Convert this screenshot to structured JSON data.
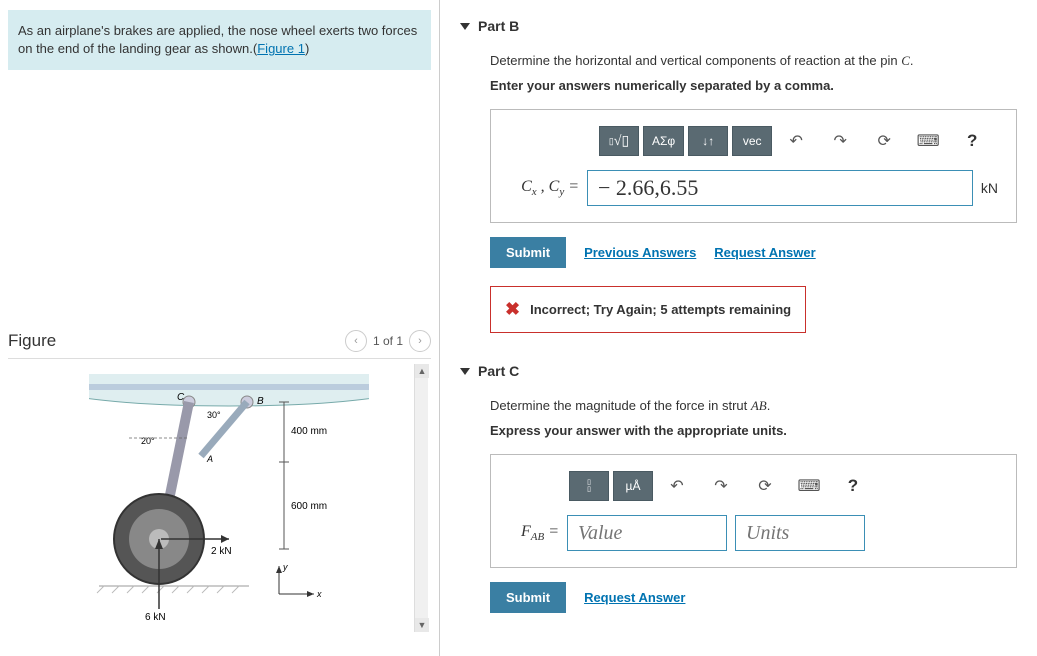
{
  "problem": {
    "text_before": "As an airplane's brakes are applied, the nose wheel exerts two forces on the end of the landing gear as shown.(",
    "link": "Figure 1",
    "text_after": ")"
  },
  "figure": {
    "title": "Figure",
    "pager": "1 of 1",
    "labels": {
      "angle1": "30°",
      "angle2": "20°",
      "dim1": "400 mm",
      "dim2": "600 mm",
      "f1": "2 kN",
      "f2": "6 kN",
      "ptB": "B",
      "ptC": "C",
      "ptA": "A",
      "x": "x",
      "y": "y"
    }
  },
  "partB": {
    "title": "Part B",
    "prompt_before": "Determine the horizontal and vertical components of reaction at the pin ",
    "prompt_var": "C",
    "prompt_after": ".",
    "instruction": "Enter your answers numerically separated by a comma.",
    "toolbar": {
      "symbols": "ΑΣφ",
      "vec": "vec"
    },
    "label_cx": "C",
    "label_sub_x": "x",
    "label_cy": "C",
    "label_sub_y": "y",
    "value": "− 2.66,6.55",
    "unit": "kN",
    "submit": "Submit",
    "prev_answers": "Previous Answers",
    "request_answer": "Request Answer",
    "feedback": "Incorrect; Try Again; 5 attempts remaining"
  },
  "partC": {
    "title": "Part C",
    "prompt_before": "Determine the magnitude of the force in strut ",
    "prompt_var": "AB",
    "prompt_after": ".",
    "instruction": "Express your answer with the appropriate units.",
    "toolbar": {
      "units": "µÅ"
    },
    "label_f": "F",
    "label_sub": "AB",
    "value_ph": "Value",
    "units_ph": "Units",
    "submit": "Submit",
    "request_answer": "Request Answer"
  }
}
